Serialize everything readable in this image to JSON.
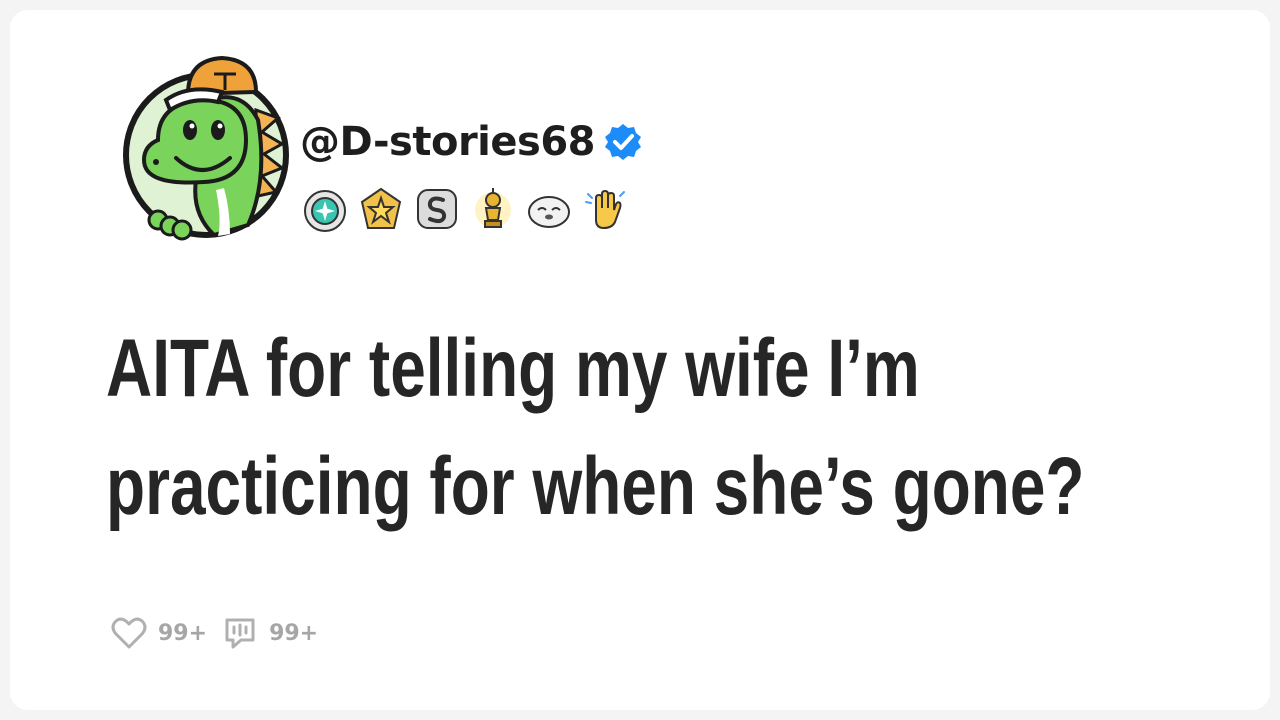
{
  "post": {
    "username": "@D-stories68",
    "verified": true,
    "title_lines": [
      "AITA for telling my wife I’m",
      "practicing for when she’s gone?"
    ]
  },
  "badges": [
    {
      "icon": "diamond-badge-icon"
    },
    {
      "icon": "star-badge-icon"
    },
    {
      "icon": "s-badge-icon"
    },
    {
      "icon": "trophy-badge-icon"
    },
    {
      "icon": "seal-badge-icon"
    },
    {
      "icon": "raised-hand-badge-icon"
    }
  ],
  "stats": {
    "likes": "99+",
    "comments": "99+"
  },
  "colors": {
    "verified_blue": "#1d8cf8",
    "avatar_green": "#7ad35a",
    "hat_orange": "#f0a23a"
  }
}
